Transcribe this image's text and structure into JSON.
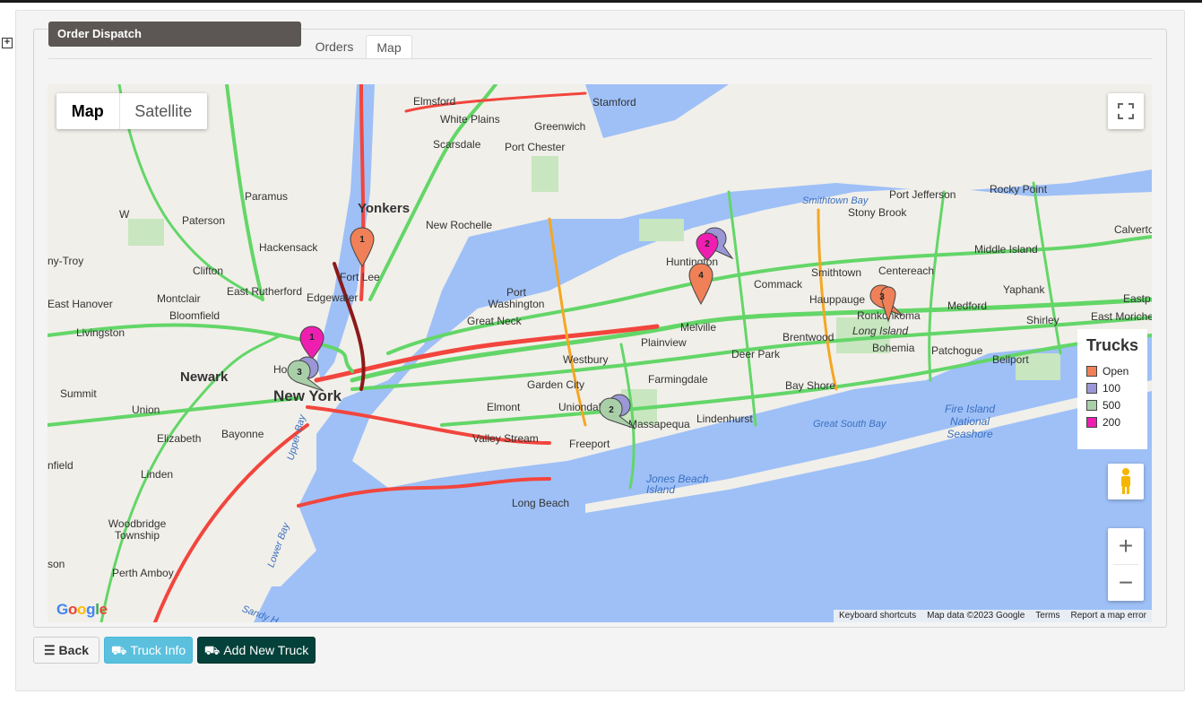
{
  "panel": {
    "title": "Order Dispatch"
  },
  "tabs": [
    {
      "label": "Orders"
    },
    {
      "label": "Map"
    }
  ],
  "map": {
    "type_controls": {
      "map": "Map",
      "satellite": "Satellite"
    },
    "legend": {
      "title": "Trucks",
      "items": [
        {
          "label": "Open",
          "color": "#f08057"
        },
        {
          "label": "100",
          "color": "#9b97d6"
        },
        {
          "label": "500",
          "color": "#a9cfa9"
        },
        {
          "label": "200",
          "color": "#ee1fb0"
        }
      ]
    },
    "attribution": {
      "shortcuts": "Keyboard shortcuts",
      "data": "Map data ©2023 Google",
      "terms": "Terms",
      "report": "Report a map error"
    },
    "logo": "Google",
    "places": {
      "new_york": "New York",
      "newark": "Newark",
      "yonkers": "Yonkers",
      "long_island": "Long Island",
      "stamford": "Stamford",
      "greenwich": "Greenwich",
      "white_plains": "White Plains",
      "elmsford": "Elmsford",
      "scarsdale": "Scarsdale",
      "port_chester": "Port Chester",
      "new_rochelle": "New Rochelle",
      "paramus": "Paramus",
      "paterson": "Paterson",
      "hackensack": "Hackensack",
      "clifton": "Clifton",
      "fort_lee": "Fort Lee",
      "edgewater": "Edgewater",
      "montclair": "Montclair",
      "east_rutherford": "East Rutherford",
      "bloomfield": "Bloomfield",
      "east_hanover": "East Hanover",
      "livingston": "Livingston",
      "summit": "Summit",
      "union": "Union",
      "elizabeth": "Elizabeth",
      "bayonne": "Bayonne",
      "linden": "Linden",
      "woodbridge": "Woodbridge Township",
      "perth_amboy": "Perth Amboy",
      "port_washington": "Port Washington",
      "great_neck": "Great Neck",
      "huntington": "Huntington",
      "commack": "Commack",
      "melville": "Melville",
      "plainview": "Plainview",
      "westbury": "Westbury",
      "garden_city": "Garden City",
      "elmont": "Elmont",
      "valley_stream": "Valley Stream",
      "uniondale": "Uniondale",
      "freeport": "Freeport",
      "massapequa": "Massapequa",
      "farmingdale": "Farmingdale",
      "lindenhurst": "Lindenhurst",
      "deer_park": "Deer Park",
      "brentwood": "Brentwood",
      "bay_shore": "Bay Shore",
      "hauppauge": "Hauppauge",
      "smithtown": "Smithtown",
      "ronkonkoma": "Ronkonkoma",
      "centereach": "Centereach",
      "stony_brook": "Stony Brook",
      "port_jefferson": "Port Jefferson",
      "rocky_point": "Rocky Point",
      "middle_island": "Middle Island",
      "yaphank": "Yaphank",
      "medford": "Medford",
      "shirley": "Shirley",
      "east_moriches": "East Moriche",
      "patchogue": "Patchogue",
      "bellport": "Bellport",
      "bohemia": "Bohemia",
      "calverton": "Calverto",
      "eastport": "Eastp",
      "long_beach": "Long Beach",
      "jones_beach": "Jones Beach Island",
      "fire_island": "Fire Island National Seashore",
      "great_south_bay": "Great South Bay",
      "smithtown_bay": "Smithtown Bay",
      "upper_bay": "Upper Bay",
      "lower_bay": "Lower Bay",
      "sandy_hook": "Sandy H",
      "any_troy": "ny-Troy",
      "field": "nfield",
      "son": "son",
      "wayne": "W",
      "ho": "Ho"
    },
    "markers": [
      {
        "label": "1",
        "color": "#f08057"
      },
      {
        "label": "2",
        "color": "#9b97d6"
      },
      {
        "label": "2",
        "color": "#ee1fb0"
      },
      {
        "label": "4",
        "color": "#f08057"
      },
      {
        "label": "3",
        "color": "#f08057"
      },
      {
        "label": "1",
        "color": "#ee1fb0"
      },
      {
        "label": "3",
        "color": "#a9cfa9"
      },
      {
        "label": "2",
        "color": "#a9cfa9"
      }
    ]
  },
  "buttons": {
    "back": "Back",
    "truck_info": "Truck Info",
    "add_truck": "Add New Truck"
  }
}
